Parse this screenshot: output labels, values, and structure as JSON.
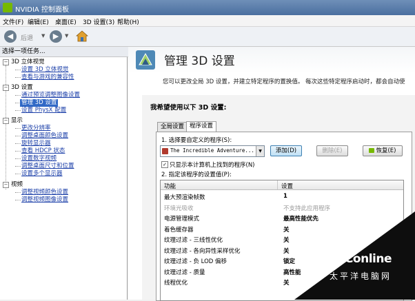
{
  "window": {
    "title": "NVIDIA 控制面板"
  },
  "menu": [
    "文件(F)",
    "编辑(E)",
    "桌面(E)",
    "3D 设置(3)",
    "帮助(H)"
  ],
  "toolbar": {
    "back_label": "后退"
  },
  "sidebar": {
    "header": "选择一项任务...",
    "items": [
      {
        "label": "3D 立体视觉",
        "type": "cat"
      },
      {
        "label": "设置 3D 立体视觉",
        "type": "link"
      },
      {
        "label": "查看与游戏的兼容性",
        "type": "link"
      },
      {
        "label": "3D 设置",
        "type": "cat"
      },
      {
        "label": "通过预览调整图像设置",
        "type": "link"
      },
      {
        "label": "管理 3D 设置",
        "type": "sel"
      },
      {
        "label": "设置 PhysX 配置",
        "type": "link"
      },
      {
        "label": "显示",
        "type": "cat"
      },
      {
        "label": "更改分辨率",
        "type": "link"
      },
      {
        "label": "调整桌面颜色设置",
        "type": "link"
      },
      {
        "label": "旋转显示器",
        "type": "link"
      },
      {
        "label": "查看 HDCP 状态",
        "type": "link"
      },
      {
        "label": "设置数字视频",
        "type": "link"
      },
      {
        "label": "调整桌面尺寸和位置",
        "type": "link"
      },
      {
        "label": "设置多个显示器",
        "type": "link"
      },
      {
        "label": "视频",
        "type": "cat"
      },
      {
        "label": "调整视频颜色设置",
        "type": "link"
      },
      {
        "label": "调整视频图像设置",
        "type": "link"
      }
    ]
  },
  "main": {
    "title": "管理 3D 设置",
    "description": "您可以更改全局 3D 设置，并建立特定程序的置换值。 每次这些特定程序启动时，都会自动使",
    "section_title": "我希望使用以下 3D 设置:",
    "tabs": [
      "全局设置",
      "程序设置"
    ],
    "step1": "1.  选择要自定义的程序(S):",
    "program": "The Incredible Adventure...",
    "buttons": {
      "add": "添加(D)",
      "delete": "删除(E)",
      "restore": "恢复(E)"
    },
    "checkbox_label": "只显示本计算机上找到的程序(N)",
    "checkbox_checked": "✓",
    "step2": "2.  指定该程序的设置值(P):",
    "table": {
      "headers": [
        "功能",
        "设置"
      ],
      "rows": [
        {
          "feature": "最大预渲染帧数",
          "value": "1",
          "style": "bold",
          "feature_style": ""
        },
        {
          "feature": "环境光吸收",
          "value": "不支持此应用程序",
          "style": "gray",
          "feature_style": "gray"
        },
        {
          "feature": "电源管理模式",
          "value": "最高性能优先",
          "style": "bold",
          "feature_style": ""
        },
        {
          "feature": "着色缓存器",
          "value": "关",
          "style": "bold",
          "feature_style": ""
        },
        {
          "feature": "纹理过滤 - 三线性优化",
          "value": "关",
          "style": "bold",
          "feature_style": ""
        },
        {
          "feature": "纹理过滤 - 各向异性采样优化",
          "value": "关",
          "style": "bold",
          "feature_style": ""
        },
        {
          "feature": "纹理过滤 - 负 LOD 偏移",
          "value": "锁定",
          "style": "bold",
          "feature_style": ""
        },
        {
          "feature": "纹理过滤 - 质量",
          "value": "高性能",
          "style": "bold",
          "feature_style": ""
        },
        {
          "feature": "线程优化",
          "value": "关",
          "style": "bold",
          "feature_style": ""
        }
      ]
    }
  },
  "watermark": {
    "brand": "PConline",
    "sub": "太平洋电脑网"
  },
  "colors": {
    "nvidia_green": "#76b900",
    "selection": "#3169c6",
    "link": "#1a3ea8"
  }
}
